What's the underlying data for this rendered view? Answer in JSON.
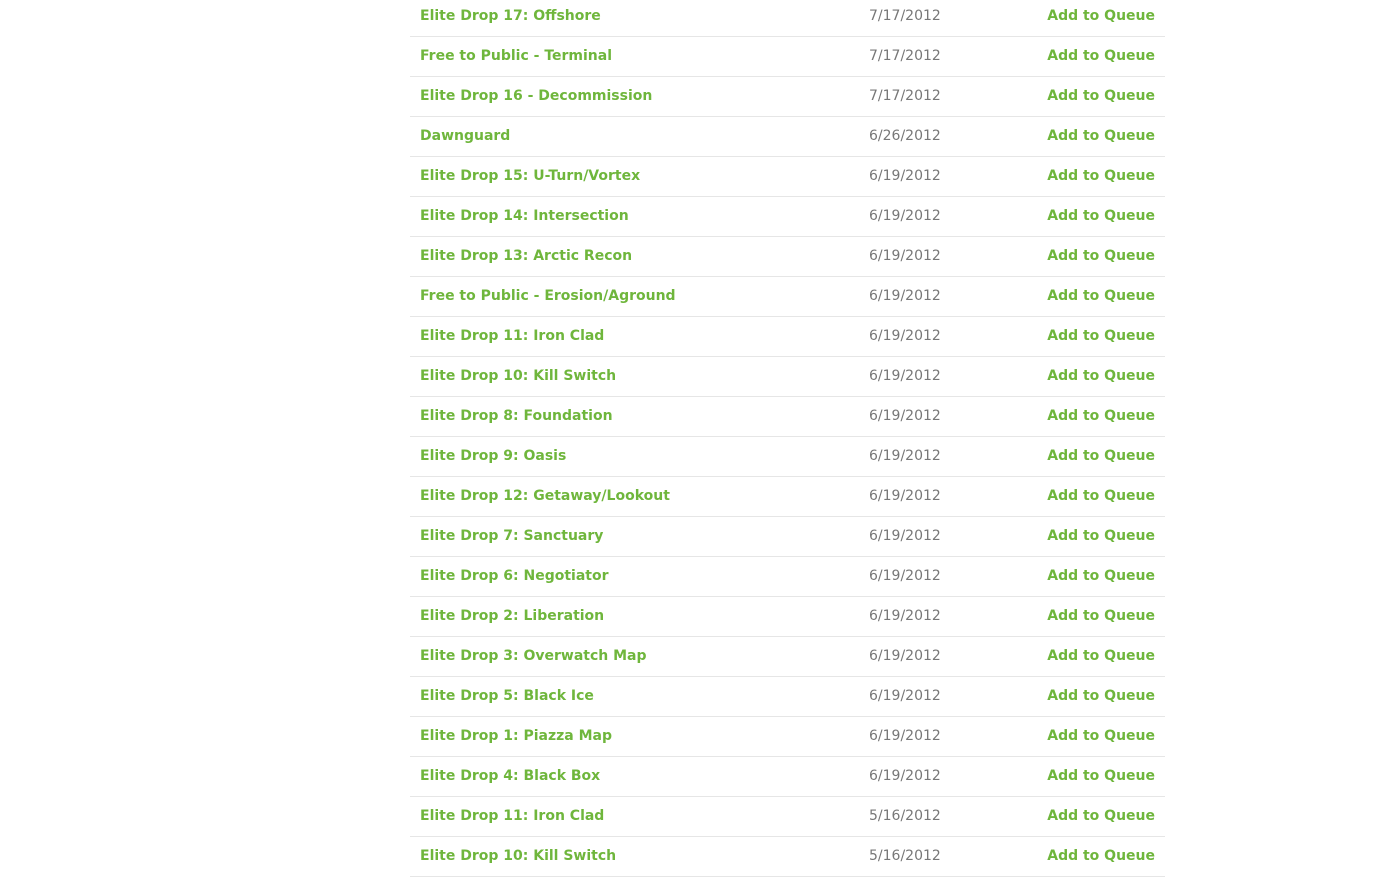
{
  "colors": {
    "link_green": "#6fb63c",
    "date_gray": "#777777",
    "divider": "#e6e6e6"
  },
  "action_label": "Add to Queue",
  "items": [
    {
      "title": "Elite Drop 17: Offshore",
      "date": "7/17/2012",
      "action": "Add to Queue"
    },
    {
      "title": "Free to Public - Terminal",
      "date": "7/17/2012",
      "action": "Add to Queue"
    },
    {
      "title": "Elite Drop 16 - Decommission",
      "date": "7/17/2012",
      "action": "Add to Queue"
    },
    {
      "title": "Dawnguard",
      "date": "6/26/2012",
      "action": "Add to Queue"
    },
    {
      "title": "Elite Drop 15: U-Turn/Vortex",
      "date": "6/19/2012",
      "action": "Add to Queue"
    },
    {
      "title": "Elite Drop 14: Intersection",
      "date": "6/19/2012",
      "action": "Add to Queue"
    },
    {
      "title": "Elite Drop 13: Arctic Recon",
      "date": "6/19/2012",
      "action": "Add to Queue"
    },
    {
      "title": "Free to Public - Erosion/Aground",
      "date": "6/19/2012",
      "action": "Add to Queue"
    },
    {
      "title": "Elite Drop 11: Iron Clad",
      "date": "6/19/2012",
      "action": "Add to Queue"
    },
    {
      "title": "Elite Drop 10: Kill Switch",
      "date": "6/19/2012",
      "action": "Add to Queue"
    },
    {
      "title": "Elite Drop 8: Foundation",
      "date": "6/19/2012",
      "action": "Add to Queue"
    },
    {
      "title": "Elite Drop 9: Oasis",
      "date": "6/19/2012",
      "action": "Add to Queue"
    },
    {
      "title": "Elite Drop 12: Getaway/Lookout",
      "date": "6/19/2012",
      "action": "Add to Queue"
    },
    {
      "title": "Elite Drop 7: Sanctuary",
      "date": "6/19/2012",
      "action": "Add to Queue"
    },
    {
      "title": "Elite Drop 6: Negotiator",
      "date": "6/19/2012",
      "action": "Add to Queue"
    },
    {
      "title": "Elite Drop 2: Liberation",
      "date": "6/19/2012",
      "action": "Add to Queue"
    },
    {
      "title": "Elite Drop 3: Overwatch Map",
      "date": "6/19/2012",
      "action": "Add to Queue"
    },
    {
      "title": "Elite Drop 5: Black Ice",
      "date": "6/19/2012",
      "action": "Add to Queue"
    },
    {
      "title": "Elite Drop 1: Piazza Map",
      "date": "6/19/2012",
      "action": "Add to Queue"
    },
    {
      "title": "Elite Drop 4: Black Box",
      "date": "6/19/2012",
      "action": "Add to Queue"
    },
    {
      "title": "Elite Drop 11: Iron Clad",
      "date": "5/16/2012",
      "action": "Add to Queue"
    },
    {
      "title": "Elite Drop 10: Kill Switch",
      "date": "5/16/2012",
      "action": "Add to Queue"
    }
  ]
}
